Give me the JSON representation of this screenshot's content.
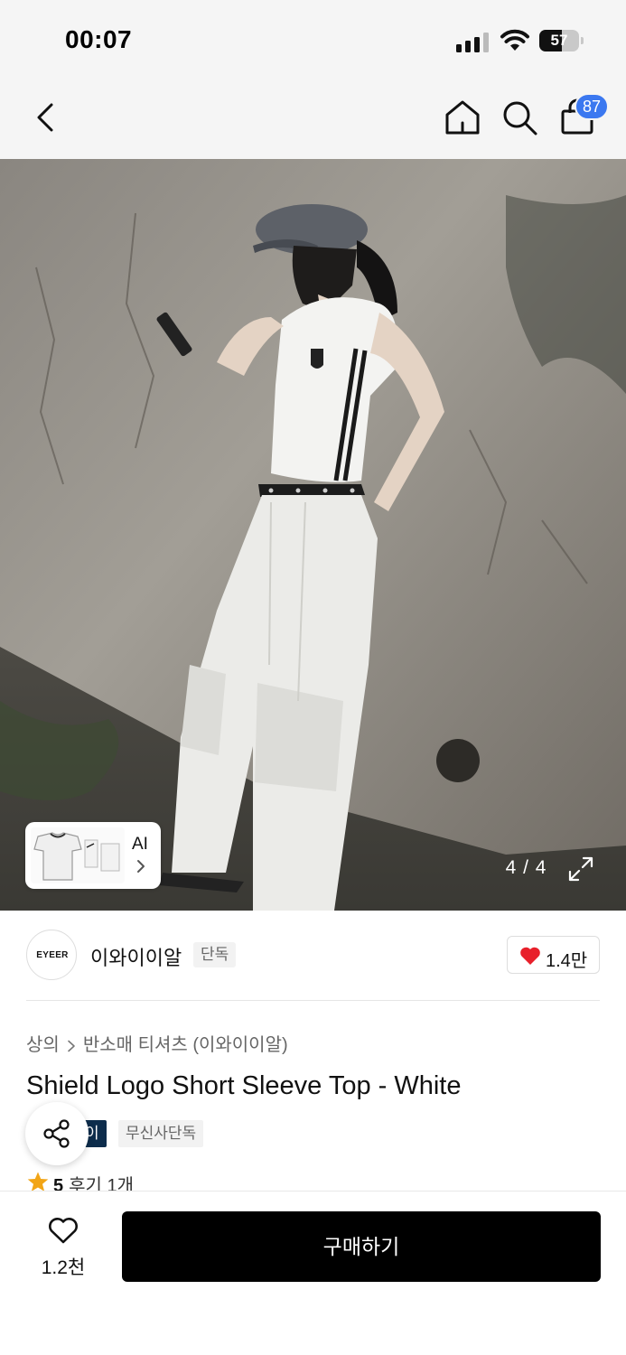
{
  "status_bar": {
    "time": "00:07",
    "battery_level": "57"
  },
  "header": {
    "cart_count": "87"
  },
  "gallery": {
    "ai_label": "AI",
    "counter": "4 / 4"
  },
  "brand": {
    "logo_text": "EYEER",
    "name": "이와이이알",
    "tag": "단독",
    "like_count": "1.4만"
  },
  "product": {
    "breadcrumb_category": "상의",
    "breadcrumb_subcategory": "반소매 티셔츠 (이와이이알)",
    "title": "Shield Logo Short Sleeve Top - White",
    "badge_dark": "이",
    "badge_light": "무신사단독",
    "rating": "5",
    "review_label": "후기 1개"
  },
  "bottom_bar": {
    "wish_count": "1.2천",
    "buy_label": "구매하기"
  },
  "colors": {
    "accent_blue": "#3b78f0",
    "heart_red": "#e8202b",
    "star_orange": "#f2a516",
    "badge_navy": "#0d2d4c",
    "buy_black": "#000000"
  },
  "icons": [
    "back-icon",
    "home-icon",
    "search-icon",
    "shopping-bag-icon",
    "expand-icon",
    "heart-icon",
    "share-icon",
    "star-icon",
    "chevron-right-icon"
  ]
}
